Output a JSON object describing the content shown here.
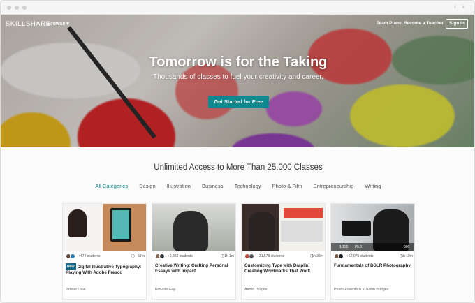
{
  "header": {
    "logo": "SKILLSHARE",
    "browse": "Browse ▾",
    "team_plans": "Team Plans",
    "become_teacher": "Become a Teacher",
    "sign_in": "Sign In"
  },
  "hero": {
    "title": "Tomorrow is for the Taking",
    "subtitle": "Thousands of classes to fuel your creativity and career.",
    "cta": "Get Started for Free"
  },
  "catalog": {
    "heading": "Unlimited Access to More Than 25,000 Classes",
    "categories": [
      "All Categories",
      "Design",
      "Illustration",
      "Business",
      "Technology",
      "Photo & Film",
      "Entrepreneurship",
      "Writing"
    ],
    "active_category": "All Categories"
  },
  "cards": [
    {
      "students": "+474 students",
      "duration": "57m",
      "badge": "NEW",
      "title": "Digital Illustrative Typography: Playing With Adobe Fresco",
      "author": "Jennet Liaw"
    },
    {
      "students": "+6,882 students",
      "duration": "1h 1m",
      "badge": "",
      "title": "Creative Writing: Crafting Personal Essays with Impact",
      "author": "Roxane Gay"
    },
    {
      "students": "+31,578 students",
      "duration": "1h 33m",
      "badge": "",
      "title": "Customizing Type with Draplin: Creating Wordmarks That Work",
      "author": "Aaron Draplin"
    },
    {
      "students": "+52,075 students",
      "duration": "1h 19m",
      "badge": "",
      "title": "Fundamentals of DSLR Photography",
      "author": "Photo Essentials x Justin Bridges",
      "camera_readout": [
        "1/125",
        "F5.6",
        "500"
      ]
    }
  ],
  "colors": {
    "accent": "#0e8a8f",
    "badge": "#1d6e8a"
  }
}
